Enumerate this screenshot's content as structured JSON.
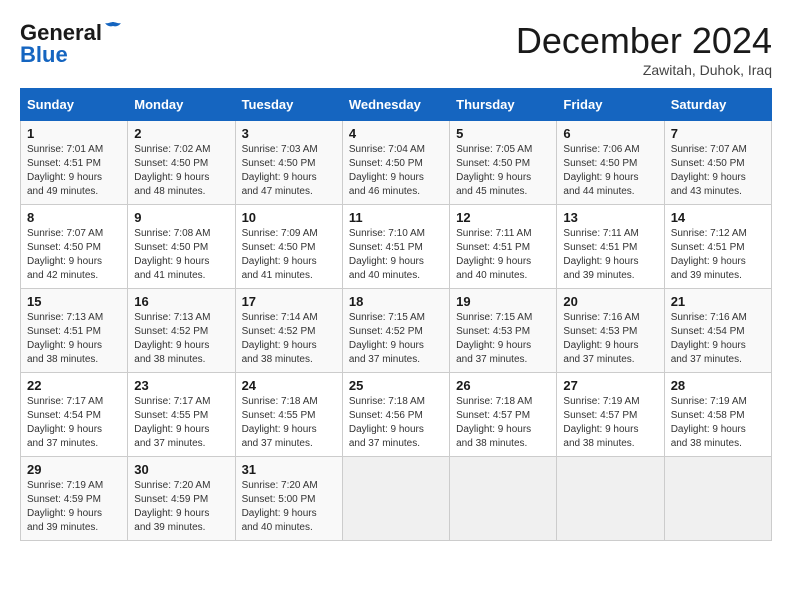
{
  "header": {
    "logo_line1": "General",
    "logo_line2": "Blue",
    "month": "December 2024",
    "location": "Zawitah, Duhok, Iraq"
  },
  "weekdays": [
    "Sunday",
    "Monday",
    "Tuesday",
    "Wednesday",
    "Thursday",
    "Friday",
    "Saturday"
  ],
  "weeks": [
    [
      {
        "day": "1",
        "sunrise": "7:01 AM",
        "sunset": "4:51 PM",
        "daylight": "9 hours and 49 minutes."
      },
      {
        "day": "2",
        "sunrise": "7:02 AM",
        "sunset": "4:50 PM",
        "daylight": "9 hours and 48 minutes."
      },
      {
        "day": "3",
        "sunrise": "7:03 AM",
        "sunset": "4:50 PM",
        "daylight": "9 hours and 47 minutes."
      },
      {
        "day": "4",
        "sunrise": "7:04 AM",
        "sunset": "4:50 PM",
        "daylight": "9 hours and 46 minutes."
      },
      {
        "day": "5",
        "sunrise": "7:05 AM",
        "sunset": "4:50 PM",
        "daylight": "9 hours and 45 minutes."
      },
      {
        "day": "6",
        "sunrise": "7:06 AM",
        "sunset": "4:50 PM",
        "daylight": "9 hours and 44 minutes."
      },
      {
        "day": "7",
        "sunrise": "7:07 AM",
        "sunset": "4:50 PM",
        "daylight": "9 hours and 43 minutes."
      }
    ],
    [
      {
        "day": "8",
        "sunrise": "7:07 AM",
        "sunset": "4:50 PM",
        "daylight": "9 hours and 42 minutes."
      },
      {
        "day": "9",
        "sunrise": "7:08 AM",
        "sunset": "4:50 PM",
        "daylight": "9 hours and 41 minutes."
      },
      {
        "day": "10",
        "sunrise": "7:09 AM",
        "sunset": "4:50 PM",
        "daylight": "9 hours and 41 minutes."
      },
      {
        "day": "11",
        "sunrise": "7:10 AM",
        "sunset": "4:51 PM",
        "daylight": "9 hours and 40 minutes."
      },
      {
        "day": "12",
        "sunrise": "7:11 AM",
        "sunset": "4:51 PM",
        "daylight": "9 hours and 40 minutes."
      },
      {
        "day": "13",
        "sunrise": "7:11 AM",
        "sunset": "4:51 PM",
        "daylight": "9 hours and 39 minutes."
      },
      {
        "day": "14",
        "sunrise": "7:12 AM",
        "sunset": "4:51 PM",
        "daylight": "9 hours and 39 minutes."
      }
    ],
    [
      {
        "day": "15",
        "sunrise": "7:13 AM",
        "sunset": "4:51 PM",
        "daylight": "9 hours and 38 minutes."
      },
      {
        "day": "16",
        "sunrise": "7:13 AM",
        "sunset": "4:52 PM",
        "daylight": "9 hours and 38 minutes."
      },
      {
        "day": "17",
        "sunrise": "7:14 AM",
        "sunset": "4:52 PM",
        "daylight": "9 hours and 38 minutes."
      },
      {
        "day": "18",
        "sunrise": "7:15 AM",
        "sunset": "4:52 PM",
        "daylight": "9 hours and 37 minutes."
      },
      {
        "day": "19",
        "sunrise": "7:15 AM",
        "sunset": "4:53 PM",
        "daylight": "9 hours and 37 minutes."
      },
      {
        "day": "20",
        "sunrise": "7:16 AM",
        "sunset": "4:53 PM",
        "daylight": "9 hours and 37 minutes."
      },
      {
        "day": "21",
        "sunrise": "7:16 AM",
        "sunset": "4:54 PM",
        "daylight": "9 hours and 37 minutes."
      }
    ],
    [
      {
        "day": "22",
        "sunrise": "7:17 AM",
        "sunset": "4:54 PM",
        "daylight": "9 hours and 37 minutes."
      },
      {
        "day": "23",
        "sunrise": "7:17 AM",
        "sunset": "4:55 PM",
        "daylight": "9 hours and 37 minutes."
      },
      {
        "day": "24",
        "sunrise": "7:18 AM",
        "sunset": "4:55 PM",
        "daylight": "9 hours and 37 minutes."
      },
      {
        "day": "25",
        "sunrise": "7:18 AM",
        "sunset": "4:56 PM",
        "daylight": "9 hours and 37 minutes."
      },
      {
        "day": "26",
        "sunrise": "7:18 AM",
        "sunset": "4:57 PM",
        "daylight": "9 hours and 38 minutes."
      },
      {
        "day": "27",
        "sunrise": "7:19 AM",
        "sunset": "4:57 PM",
        "daylight": "9 hours and 38 minutes."
      },
      {
        "day": "28",
        "sunrise": "7:19 AM",
        "sunset": "4:58 PM",
        "daylight": "9 hours and 38 minutes."
      }
    ],
    [
      {
        "day": "29",
        "sunrise": "7:19 AM",
        "sunset": "4:59 PM",
        "daylight": "9 hours and 39 minutes."
      },
      {
        "day": "30",
        "sunrise": "7:20 AM",
        "sunset": "4:59 PM",
        "daylight": "9 hours and 39 minutes."
      },
      {
        "day": "31",
        "sunrise": "7:20 AM",
        "sunset": "5:00 PM",
        "daylight": "9 hours and 40 minutes."
      },
      null,
      null,
      null,
      null
    ]
  ],
  "labels": {
    "sunrise": "Sunrise: ",
    "sunset": "Sunset: ",
    "daylight": "Daylight hours"
  }
}
